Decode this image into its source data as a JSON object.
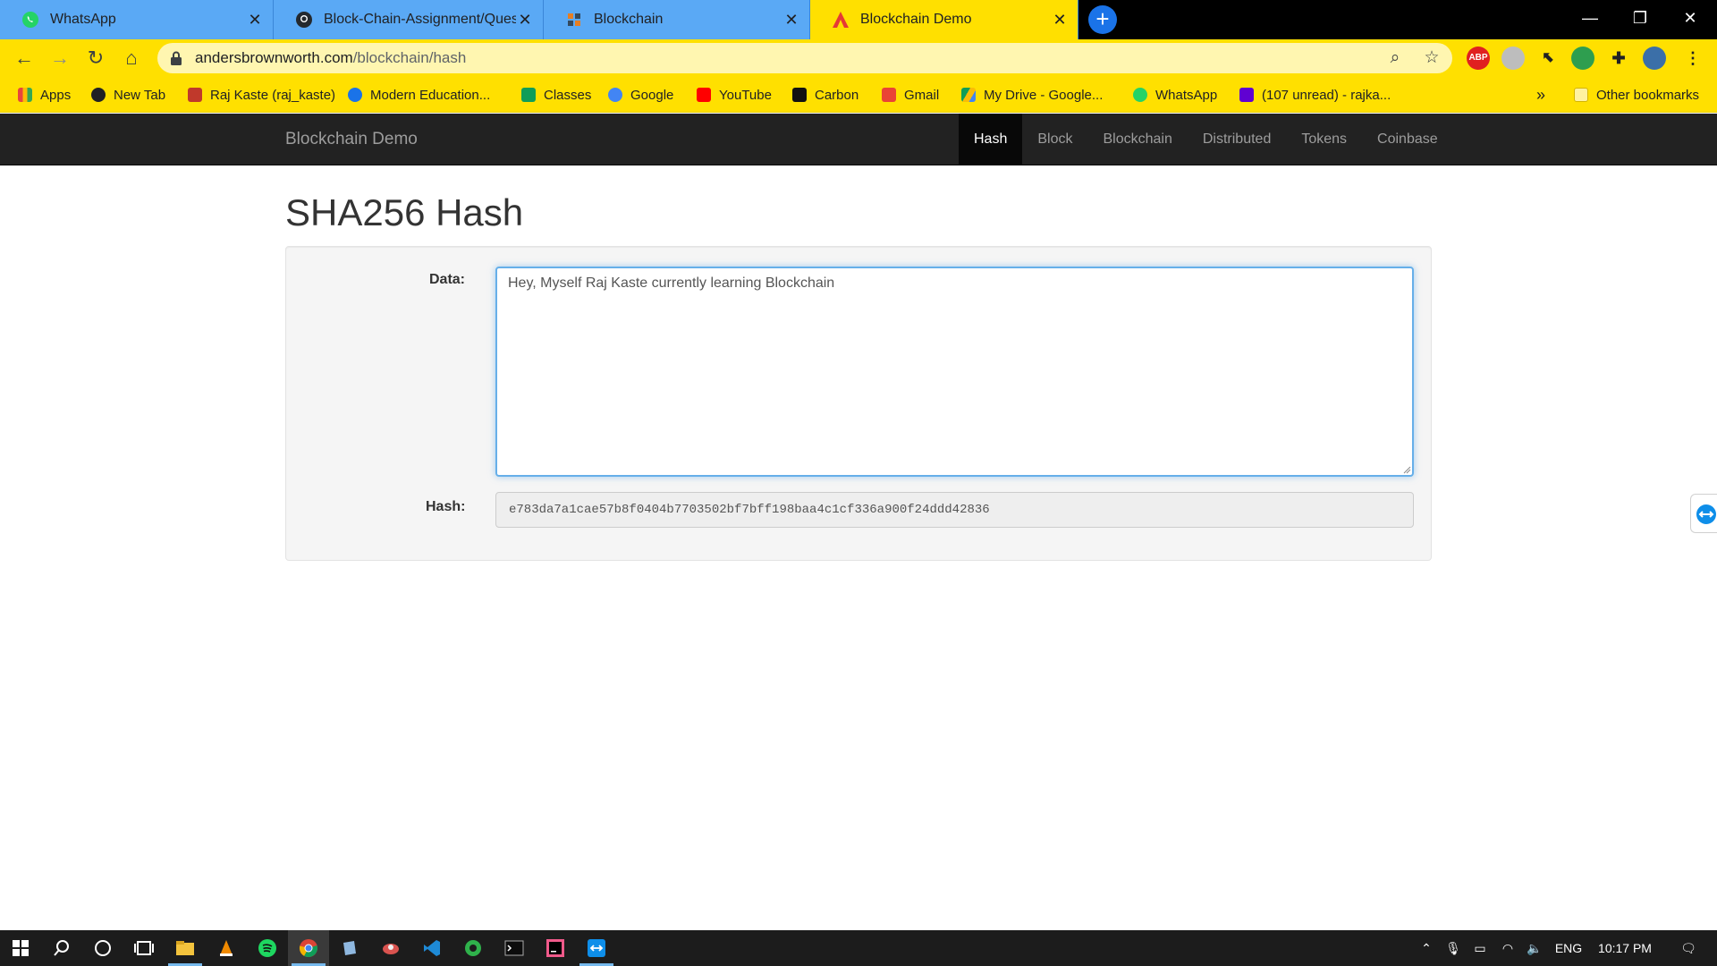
{
  "browser": {
    "tabs": [
      {
        "title": "WhatsApp",
        "icon": "whatsapp-icon",
        "active": false
      },
      {
        "title": "Block-Chain-Assignment/Questic",
        "icon": "github-icon",
        "active": false
      },
      {
        "title": "Blockchain",
        "icon": "blockchain-icon",
        "active": false
      },
      {
        "title": "Blockchain Demo",
        "icon": "anders-icon",
        "active": true
      }
    ],
    "tab_close": "✕",
    "new_tab": "+",
    "url_domain": "andersbrownworth.com",
    "url_path": "/blockchain/hash",
    "colors": {
      "tab_inactive": "#5aa9f5",
      "tab_active": "#ffe000",
      "toolbar": "#ffe000"
    }
  },
  "bookmarks": [
    {
      "label": "Apps",
      "icon": "apps-grid-icon",
      "color": "#e8453c"
    },
    {
      "label": "New Tab",
      "icon": "globe-icon",
      "color": "#202124"
    },
    {
      "label": "Raj Kaste (raj_kaste)",
      "icon": "user-icon",
      "color": "#c0392b"
    },
    {
      "label": "Modern Education...",
      "icon": "infinity-icon",
      "color": "#1a73e8"
    },
    {
      "label": "Classes",
      "icon": "classroom-icon",
      "color": "#0f9d58"
    },
    {
      "label": "Google",
      "icon": "google-icon",
      "color": "#4285f4"
    },
    {
      "label": "YouTube",
      "icon": "youtube-icon",
      "color": "#ff0000"
    },
    {
      "label": "Carbon",
      "icon": "carbon-icon",
      "color": "#111111"
    },
    {
      "label": "Gmail",
      "icon": "gmail-icon",
      "color": "#ea4335"
    },
    {
      "label": "My Drive - Google...",
      "icon": "drive-icon",
      "color": "#0f9d58"
    },
    {
      "label": "WhatsApp",
      "icon": "whatsapp-icon",
      "color": "#25d366"
    },
    {
      "label": "(107 unread) - rajka...",
      "icon": "yahoo-mail-icon",
      "color": "#6001d2"
    }
  ],
  "bookmarks_overflow": "»",
  "other_bookmarks": "Other bookmarks",
  "site": {
    "brand": "Blockchain Demo",
    "nav": [
      "Hash",
      "Block",
      "Blockchain",
      "Distributed",
      "Tokens",
      "Coinbase"
    ],
    "active_nav": "Hash",
    "page_title": "SHA256 Hash",
    "data_label": "Data:",
    "data_value": "Hey, Myself Raj Kaste currently learning Blockchain",
    "hash_label": "Hash:",
    "hash_value": "e783da7a1cae57b8f0404b7703502bf7bff198baa4c1cf336a900f24ddd42836"
  },
  "taskbar": {
    "apps": [
      "start-icon",
      "search-icon",
      "cortana-icon",
      "task-view-icon",
      "file-explorer-icon",
      "vlc-icon",
      "spotify-icon",
      "chrome-icon",
      "notes-icon",
      "game-icon",
      "vscode-icon",
      "network-app-icon",
      "terminal-icon",
      "intellij-icon",
      "teamviewer-icon"
    ],
    "language": "ENG",
    "time": "10:17 PM"
  }
}
